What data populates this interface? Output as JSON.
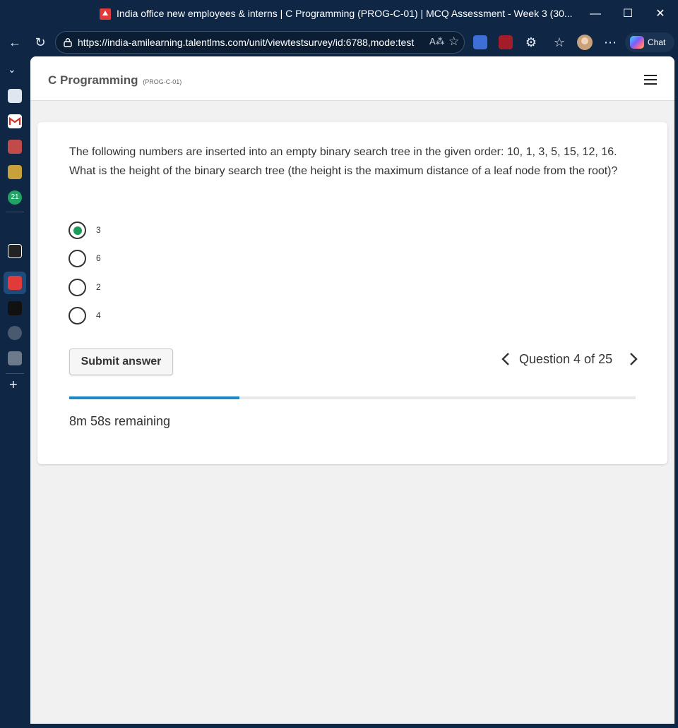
{
  "window": {
    "title": "India office new employees & interns | C Programming (PROG-C-01) | MCQ Assessment - Week 3 (30..."
  },
  "browser": {
    "url": "https://india-amilearning.talentlms.com/unit/viewtestsurvey/id:6788,mode:test",
    "chat_label": "Chat",
    "sidebar_badge": "21"
  },
  "header": {
    "course_title": "C Programming",
    "course_code": "(PROG-C-01)"
  },
  "question": {
    "text": "The following numbers are inserted into an empty binary search tree in the given order: 10, 1, 3, 5, 15, 12, 16. What is the height of the binary search tree (the height is the maximum distance of a leaf node from the root)?",
    "options": [
      {
        "label": "3",
        "selected": true
      },
      {
        "label": "6",
        "selected": false
      },
      {
        "label": "2",
        "selected": false
      },
      {
        "label": "4",
        "selected": false
      }
    ]
  },
  "footer": {
    "submit_label": "Submit answer",
    "counter": "Question 4 of 25",
    "progress_fraction": 0.3,
    "time_remaining": "8m 58s remaining"
  },
  "colors": {
    "selected_radio": "#1a9b57",
    "progress": "#1e88c7",
    "chrome": "#0f2644"
  }
}
